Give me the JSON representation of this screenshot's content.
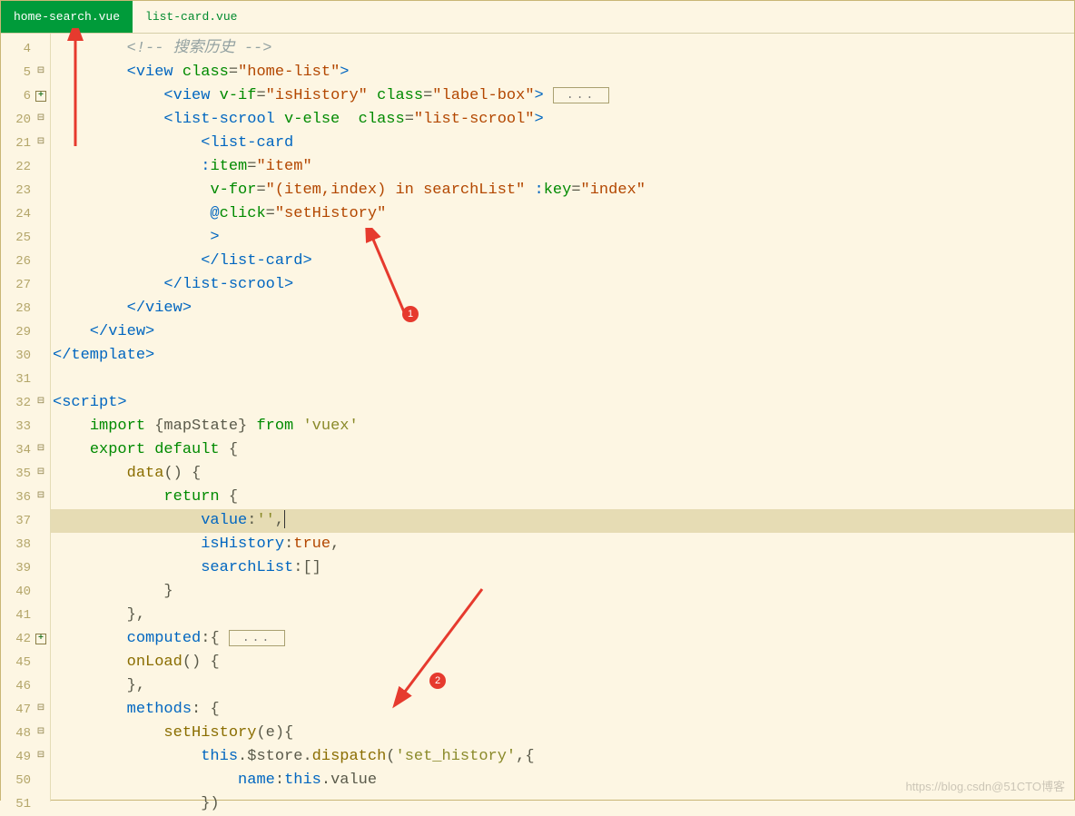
{
  "tabs": [
    {
      "label": "home-search.vue",
      "active": true
    },
    {
      "label": "list-card.vue",
      "active": false
    }
  ],
  "gutter": [
    {
      "n": "4",
      "fold": ""
    },
    {
      "n": "5",
      "fold": "⊟"
    },
    {
      "n": "6",
      "fold": "+"
    },
    {
      "n": "20",
      "fold": "⊟"
    },
    {
      "n": "21",
      "fold": "⊟"
    },
    {
      "n": "22",
      "fold": ""
    },
    {
      "n": "23",
      "fold": ""
    },
    {
      "n": "24",
      "fold": ""
    },
    {
      "n": "25",
      "fold": ""
    },
    {
      "n": "26",
      "fold": ""
    },
    {
      "n": "27",
      "fold": ""
    },
    {
      "n": "28",
      "fold": ""
    },
    {
      "n": "29",
      "fold": ""
    },
    {
      "n": "30",
      "fold": ""
    },
    {
      "n": "31",
      "fold": ""
    },
    {
      "n": "32",
      "fold": "⊟"
    },
    {
      "n": "33",
      "fold": ""
    },
    {
      "n": "34",
      "fold": "⊟"
    },
    {
      "n": "35",
      "fold": "⊟"
    },
    {
      "n": "36",
      "fold": "⊟"
    },
    {
      "n": "37",
      "fold": ""
    },
    {
      "n": "38",
      "fold": ""
    },
    {
      "n": "39",
      "fold": ""
    },
    {
      "n": "40",
      "fold": ""
    },
    {
      "n": "41",
      "fold": ""
    },
    {
      "n": "42",
      "fold": "+"
    },
    {
      "n": "45",
      "fold": ""
    },
    {
      "n": "46",
      "fold": ""
    },
    {
      "n": "47",
      "fold": "⊟"
    },
    {
      "n": "48",
      "fold": "⊟"
    },
    {
      "n": "49",
      "fold": "⊟"
    },
    {
      "n": "50",
      "fold": ""
    },
    {
      "n": "51",
      "fold": ""
    }
  ],
  "lines": {
    "l4": "        <!-- 搜索历史 -->",
    "l5a": "        <",
    "l5b": "view ",
    "l5c": "class",
    "l5d": "=",
    "l5e": "\"home-list\"",
    "l5f": ">",
    "l6a": "            <",
    "l6b": "view ",
    "l6c": "v-if",
    "l6d": "=",
    "l6e": "\"isHistory\" ",
    "l6f": "class",
    "l6g": "=",
    "l6h": "\"label-box\"",
    "l6i": "> ",
    "l20a": "            <",
    "l20b": "list-scrool ",
    "l20c": "v-else  ",
    "l20d": "class",
    "l20e": "=",
    "l20f": "\"list-scrool\"",
    "l20g": ">",
    "l21a": "                <",
    "l21b": "list-card",
    "l22a": "                :",
    "l22b": "item",
    "l22c": "=",
    "l22d": "\"item\"",
    "l23a": "                 ",
    "l23b": "v-for",
    "l23c": "=",
    "l23d": "\"(item,index) in searchList\" ",
    "l23e": ":",
    "l23f": "key",
    "l23g": "=",
    "l23h": "\"index\"",
    "l24a": "                 @",
    "l24b": "click",
    "l24c": "=",
    "l24d": "\"setHistory\"",
    "l25": "                 >",
    "l26a": "                </",
    "l26b": "list-card",
    "l26c": ">",
    "l27a": "            </",
    "l27b": "list-scrool",
    "l27c": ">",
    "l28a": "        </",
    "l28b": "view",
    "l28c": ">",
    "l29a": "    </",
    "l29b": "view",
    "l29c": ">",
    "l30a": "</",
    "l30b": "template",
    "l30c": ">",
    "l32a": "<",
    "l32b": "script",
    "l32c": ">",
    "l33a": "    ",
    "l33b": "import ",
    "l33c": "{mapState} ",
    "l33d": "from ",
    "l33e": "'vuex'",
    "l34a": "    ",
    "l34b": "export default ",
    "l34c": "{",
    "l35a": "        ",
    "l35b": "data",
    "l35c": "() {",
    "l36a": "            ",
    "l36b": "return ",
    "l36c": "{",
    "l37a": "                ",
    "l37b": "value",
    "l37c": ":",
    "l37d": "''",
    "l37e": ",",
    "l38a": "                ",
    "l38b": "isHistory",
    "l38c": ":",
    "l38d": "true",
    "l38e": ",",
    "l39a": "                ",
    "l39b": "searchList",
    "l39c": ":[]",
    "l40": "            }",
    "l41": "        },",
    "l42a": "        ",
    "l42b": "computed",
    "l42c": ":{ ",
    "l45a": "        ",
    "l45b": "onLoad",
    "l45c": "() {",
    "l46": "        },",
    "l47a": "        ",
    "l47b": "methods",
    "l47c": ": {",
    "l48a": "            ",
    "l48b": "setHistory",
    "l48c": "(e){",
    "l49a": "                ",
    "l49b": "this",
    "l49c": ".$store.",
    "l49d": "dispatch",
    "l49e": "(",
    "l49f": "'set_history'",
    "l49g": ",{",
    "l50a": "                    ",
    "l50b": "name",
    "l50c": ":",
    "l50d": "this",
    "l50e": ".value",
    "l51": "                })"
  },
  "foldbox": "...",
  "badges": {
    "b1": "1",
    "b2": "2"
  },
  "watermark": "https://blog.csdn@51CTO博客"
}
